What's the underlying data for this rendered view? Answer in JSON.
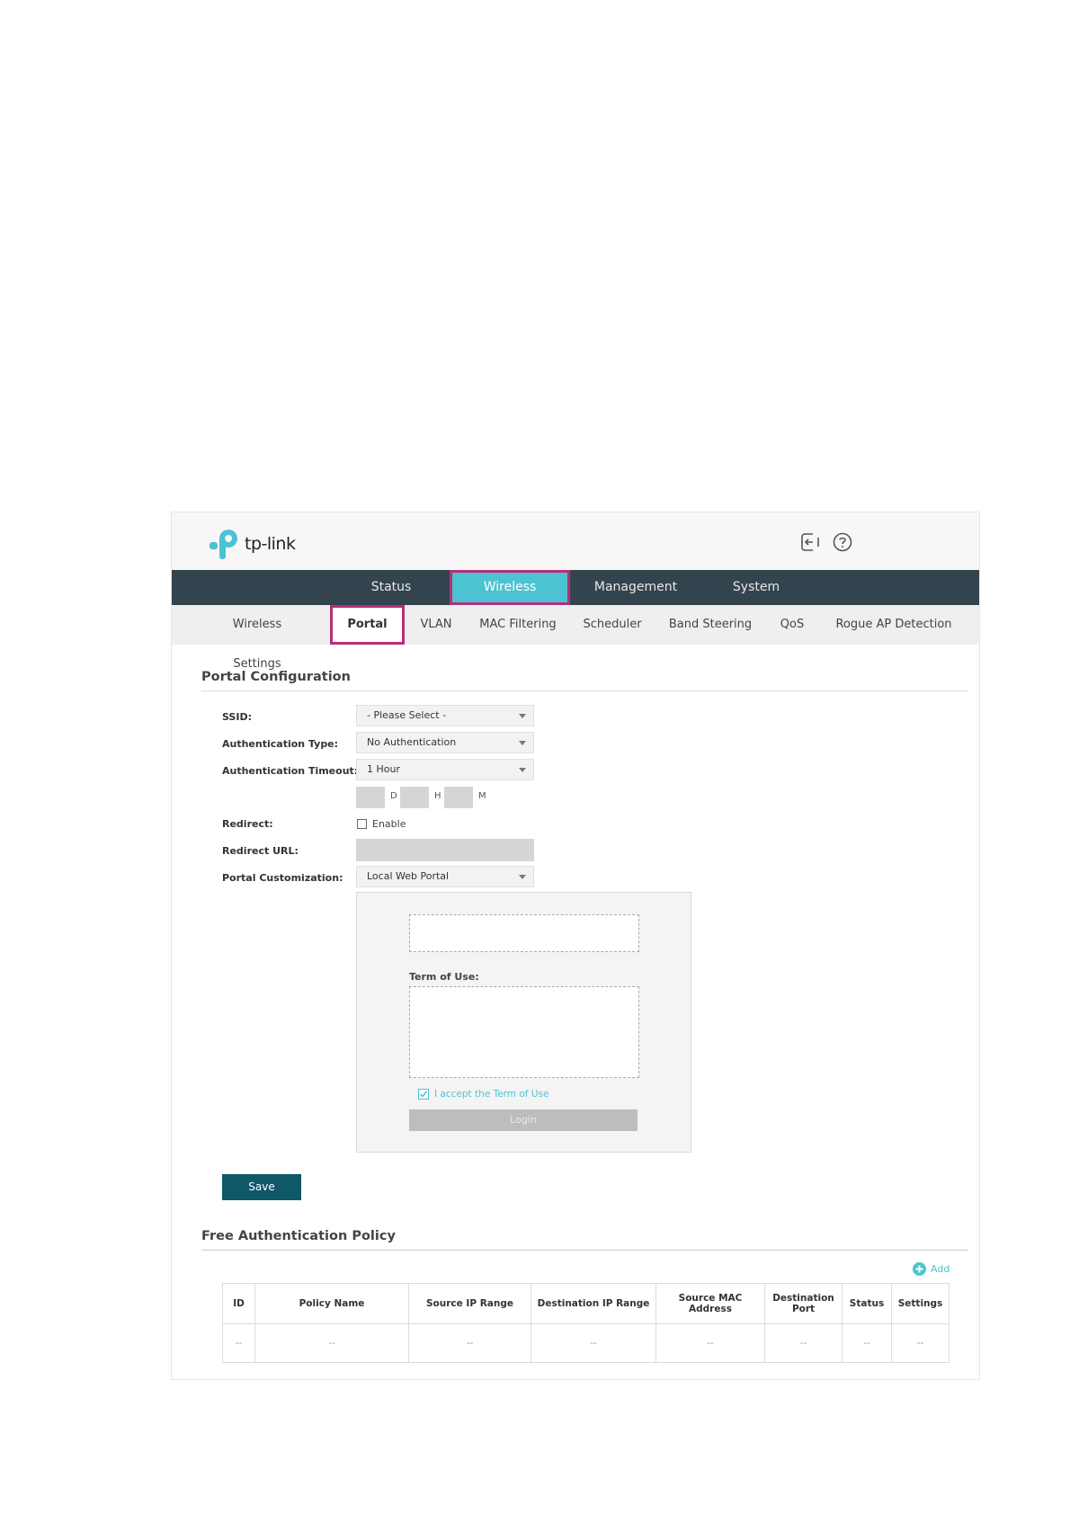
{
  "header": {
    "logo_text": "tp-link",
    "icons": [
      "logout-icon",
      "help-icon"
    ]
  },
  "main_nav": [
    {
      "label": "Status",
      "active": false
    },
    {
      "label": "Wireless",
      "active": true
    },
    {
      "label": "Management",
      "active": false
    },
    {
      "label": "System",
      "active": false
    }
  ],
  "sub_nav": [
    {
      "label": "Wireless Settings",
      "active": false
    },
    {
      "label": "Portal",
      "active": true
    },
    {
      "label": "VLAN",
      "active": false
    },
    {
      "label": "MAC Filtering",
      "active": false
    },
    {
      "label": "Scheduler",
      "active": false
    },
    {
      "label": "Band Steering",
      "active": false
    },
    {
      "label": "QoS",
      "active": false
    },
    {
      "label": "Rogue AP Detection",
      "active": false
    }
  ],
  "portal_config": {
    "title": "Portal Configuration",
    "ssid_label": "SSID:",
    "ssid_value": "- Please Select -",
    "auth_type_label": "Authentication Type:",
    "auth_type_value": "No Authentication",
    "auth_timeout_label": "Authentication Timeout:",
    "auth_timeout_value": "1 Hour",
    "timeout_units": {
      "d": "D",
      "h": "H",
      "m": "M"
    },
    "redirect_label": "Redirect:",
    "redirect_option": "Enable",
    "redirect_checked": false,
    "redirect_url_label": "Redirect URL:",
    "customization_label": "Portal Customization:",
    "customization_value": "Local Web Portal",
    "preview": {
      "term_label": "Term of Use:",
      "accept_text": "I accept the Term of Use",
      "accept_checked": true,
      "login_label": "Login"
    },
    "save_label": "Save"
  },
  "free_auth": {
    "title": "Free Authentication Policy",
    "add_label": "Add",
    "columns": [
      "ID",
      "Policy Name",
      "Source IP Range",
      "Destination IP Range",
      "Source MAC Address",
      "Destination Port",
      "Status",
      "Settings"
    ],
    "rows": [
      [
        "--",
        "--",
        "--",
        "--",
        "--",
        "--",
        "--",
        "--"
      ]
    ]
  },
  "colors": {
    "nav_bg": "#34444f",
    "active_tab": "#4cc3d3",
    "highlight_outline": "#b72f7a",
    "save_button": "#0e5868",
    "accent_link": "#4cc3d3"
  }
}
